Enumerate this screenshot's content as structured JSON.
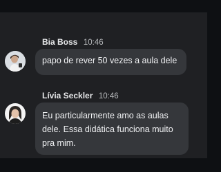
{
  "messages": [
    {
      "author": "Bia Boss",
      "time": "10:46",
      "text": "papo de rever 50 vezes a aula dele"
    },
    {
      "author": "Lívia Seckler",
      "time": "10:46",
      "text": "Eu particularmente amo as aulas dele. Essa didática funciona muito pra mim."
    }
  ],
  "colors": {
    "page_background": "#0e1013",
    "panel_background": "#1f2023",
    "bubble_background": "#35373b",
    "author_text": "#e7e8ea",
    "time_text": "#b9bbbe",
    "message_text": "#f1f2f4"
  }
}
